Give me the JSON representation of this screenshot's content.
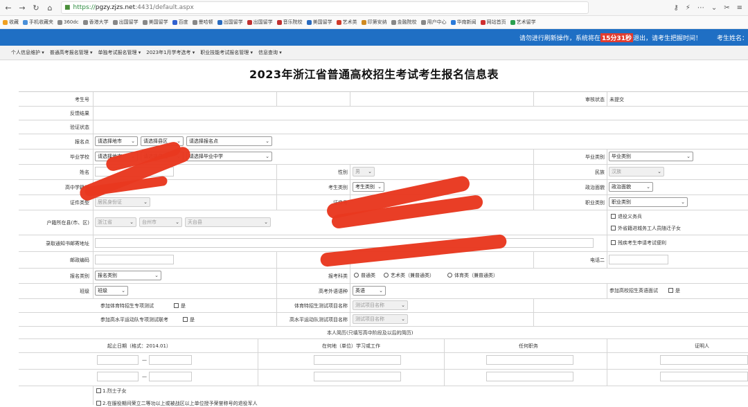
{
  "browser": {
    "url_proto": "https://",
    "url_host": "pgzy.zjzs.net",
    "url_path": ":4431/default.aspx",
    "bookmarks": [
      "收藏",
      "手机收藏夹",
      "360dc",
      "香港大学",
      "出国留学",
      "美国留学",
      "百度",
      "曼哈顿",
      "出国留学",
      "出国留学",
      "音乐院校",
      "美国留学",
      "艺术类",
      "印第安纳",
      "金融院校",
      "用户中心",
      "华南新闻",
      "网站首页",
      "艺术留学"
    ]
  },
  "notice": {
    "before": "请勿进行刷新操作，系统将在",
    "count": "15分31秒",
    "after": "退出，请考生把握时间！",
    "name_label": "考生姓名："
  },
  "menu": [
    "个人信息维护 ▾",
    "普通高考报名管理 ▾",
    "单独考试报名管理 ▾",
    "2023年1月学考选考 ▾",
    "职业技能考试报名管理 ▾",
    "信息查询 ▾"
  ],
  "title": "2023年浙江省普通高校招生考试考生报名信息表",
  "form": {
    "exam_no": "考生号",
    "audit_status_label": "审核状态",
    "audit_status_value": "未提交",
    "feedback": "反馈结果",
    "verify": "验证状态",
    "report_point": "报名点",
    "select_city": "请选择地市",
    "select_county": "请选择县区",
    "select_point": "请选择报名点",
    "grad_school": "毕业学校",
    "select_grad_school": "请选择毕业中学",
    "grad_type_label": "毕业类别",
    "grad_type_value": "毕业类别",
    "name": "姓名",
    "gender_label": "性别",
    "gender_value": "男",
    "ethnicity_label": "民族",
    "ethnicity_value": "汉族",
    "hs_no": "高中学籍号",
    "exam_type_label": "考生类别",
    "exam_type_value": "考生类别",
    "politics_label": "政治面貌",
    "politics_value": "政治面貌",
    "id_type_label": "证件类型",
    "id_type_value": "居民身份证",
    "id_no_label": "证件号",
    "job_type_label": "职业类别",
    "job_type_value": "职业类别",
    "hukou_label": "户籍所在县(市、区)",
    "prov": "浙江省",
    "city": "台州市",
    "county": "天台县",
    "veteran": "退役义务兵",
    "migrant": "外省籍进城务工人员随迁子女",
    "mail_addr": "录取通知书邮寄地址",
    "disabled": "残疾考生申请考试便利",
    "postcode": "邮政编码",
    "phone2": "电话二",
    "apply_type_label": "报名类别",
    "apply_type_value": "报名类别",
    "subject_label": "报考科类",
    "subject_opts": [
      "普通类",
      "艺术类（兼普通类）",
      "体育类（兼普通类）"
    ],
    "class_label": "班级",
    "class_value": "班级",
    "lang_label": "高考外语语种",
    "lang_value": "英语",
    "oral_test": "参加高校招生英语面试",
    "oral_yes": "是",
    "sports_test": "参加体育特招生专项测试",
    "sports_yes": "是",
    "sports_item_label": "体育特招生测试项目名称",
    "test_item": "测试项目名称",
    "team_test": "参加高水平运动队专项测试联考",
    "team_yes": "是",
    "team_item_label": "高水平运动队测试项目名称",
    "resume_title": "本人简历(只填写高中阶段及以后的简历)",
    "col_date": "起止日期（格式：2014.01）",
    "col_place": "在何地（单位）学习或工作",
    "col_role": "任何职务",
    "col_witness": "证明人",
    "dash": "—",
    "martyr": "1.烈士子女",
    "more_text": "2.在服役期间荣立二等功以上或被战区以上单位授予荣誉称号的退役军人"
  },
  "colors": {
    "notice_bg": "#1f6fc4",
    "redact": "#e8381f"
  }
}
